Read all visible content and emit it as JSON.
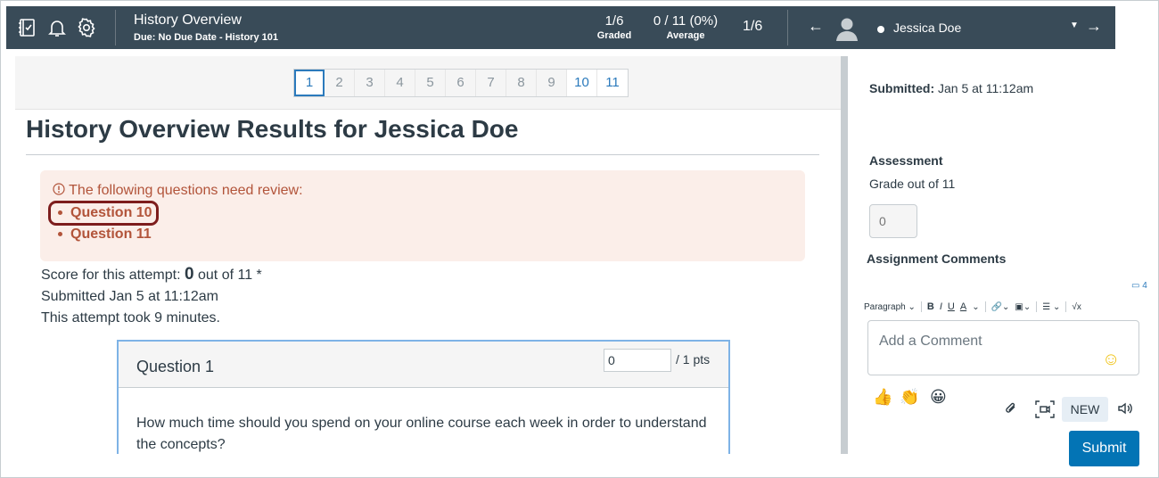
{
  "topbar": {
    "assignment_title": "History Overview",
    "assignment_sub": "Due: No Due Date - History 101",
    "graded_value": "1/6",
    "graded_label": "Graded",
    "average_value": "0 / 11 (0%)",
    "average_label": "Average",
    "student_index": "1/6",
    "student_name": "Jessica Doe",
    "icons": [
      "gradebook-icon",
      "bell-icon",
      "gear-icon",
      "arrow-left-icon",
      "avatar-icon",
      "chevron-down-icon",
      "arrow-right-icon"
    ]
  },
  "pager": {
    "pages": [
      "1",
      "2",
      "3",
      "4",
      "5",
      "6",
      "7",
      "8",
      "9",
      "10",
      "11"
    ],
    "current": "1"
  },
  "main": {
    "title": "History Overview Results for Jessica Doe",
    "alert_heading": "The following questions need review:",
    "review_items": [
      "Question 10",
      "Question 11"
    ],
    "score_prefix": "Score for this attempt:",
    "score_value": "0",
    "score_suffix": "out of 11 *",
    "submitted_text": "Submitted Jan 5 at 11:12am",
    "duration_text": "This attempt took 9 minutes.",
    "question": {
      "title": "Question 1",
      "points_input": "0",
      "points_total": "/ 1 pts",
      "body": "How much time should you spend on your online course each week in order to understand the concepts?"
    }
  },
  "sidebar": {
    "submitted_label": "Submitted:",
    "submitted_value": "Jan 5 at 11:12am",
    "assessment_heading": "Assessment",
    "grade_label": "Grade out of 11",
    "grade_placeholder": "0",
    "comments_heading": "Assignment Comments",
    "comment_count": "4",
    "toolbar": {
      "paragraph": "Paragraph",
      "bold": "B",
      "italic": "I",
      "underline": "U",
      "color": "A"
    },
    "comment_placeholder": "Add a Comment",
    "new_label": "NEW",
    "submit_label": "Submit"
  },
  "colors": {
    "topbar_bg": "#394b58",
    "link_blue": "#2b7abc",
    "alert_bg": "#fbeee9",
    "alert_text": "#b2543a",
    "highlight_border": "#7d1d1d",
    "submit_bg": "#0374b5"
  }
}
